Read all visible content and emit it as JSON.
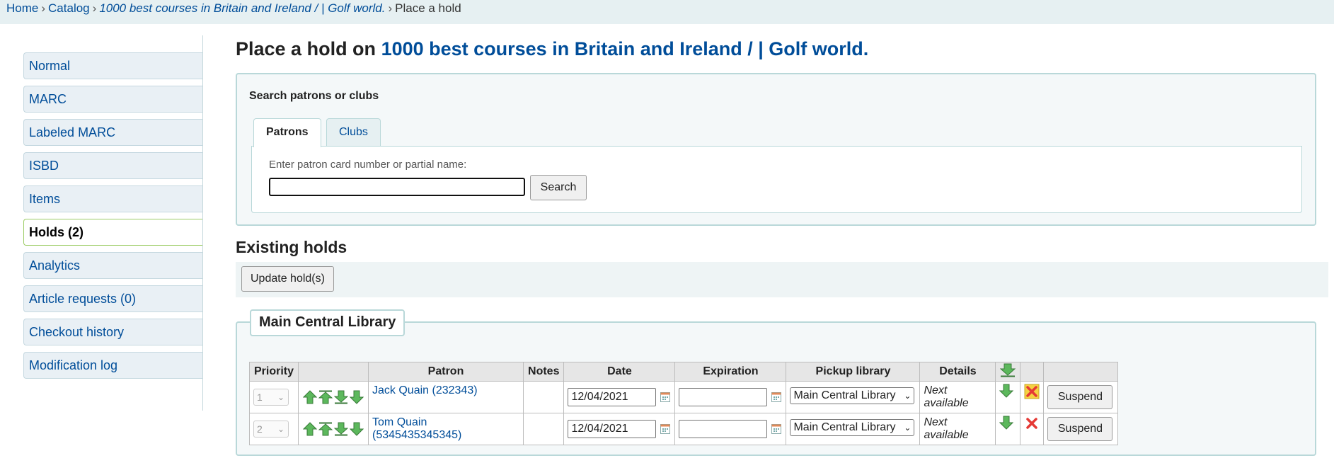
{
  "breadcrumb": {
    "home": "Home",
    "catalog": "Catalog",
    "title": "1000 best courses in Britain and Ireland / | Golf world.",
    "current": "Place a hold",
    "separator": "›"
  },
  "sidebar": {
    "items": [
      {
        "label": "Normal"
      },
      {
        "label": "MARC"
      },
      {
        "label": "Labeled MARC"
      },
      {
        "label": "ISBD"
      },
      {
        "label": "Items"
      },
      {
        "label": "Holds (2)",
        "active": true
      },
      {
        "label": "Analytics"
      },
      {
        "label": "Article requests (0)"
      },
      {
        "label": "Checkout history"
      },
      {
        "label": "Modification log"
      }
    ]
  },
  "page": {
    "title_prefix": "Place a hold on",
    "title_link": "1000 best courses in Britain and Ireland / | Golf world."
  },
  "search": {
    "legend": "Search patrons or clubs",
    "tabs": [
      {
        "label": "Patrons",
        "active": true
      },
      {
        "label": "Clubs"
      }
    ],
    "input_label": "Enter patron card number or partial name:",
    "input_value": "",
    "button": "Search"
  },
  "existing": {
    "title": "Existing holds",
    "update_button": "Update hold(s)",
    "library": "Main Central Library",
    "columns": [
      "Priority",
      "",
      "Patron",
      "Notes",
      "Date",
      "Expiration",
      "Pickup library",
      "Details",
      "",
      "",
      ""
    ],
    "rows": [
      {
        "priority": "1",
        "patron": "Jack Quain (232343)",
        "notes": "",
        "date": "12/04/2021",
        "expiration": "",
        "pickup": "Main Central Library",
        "details": "Next available",
        "delete_highlight": true,
        "action": "Suspend"
      },
      {
        "priority": "2",
        "patron": "Tom Quain (5345435345345)",
        "notes": "",
        "date": "12/04/2021",
        "expiration": "",
        "pickup": "Main Central Library",
        "details": "Next available",
        "delete_highlight": false,
        "action": "Suspend"
      }
    ]
  },
  "icons": {
    "move_up": "arrow-up-icon",
    "move_top": "arrow-top-icon",
    "move_bottom": "arrow-bottom-icon",
    "move_down": "arrow-down-icon",
    "calendar": "calendar-icon",
    "delete": "delete-icon"
  },
  "colors": {
    "link": "#004d99",
    "arrow_green": "#5cb85c",
    "delete_red": "#e53935",
    "panel_border": "#b9d8d9",
    "breadcrumb_bg": "#e6f0f2"
  }
}
